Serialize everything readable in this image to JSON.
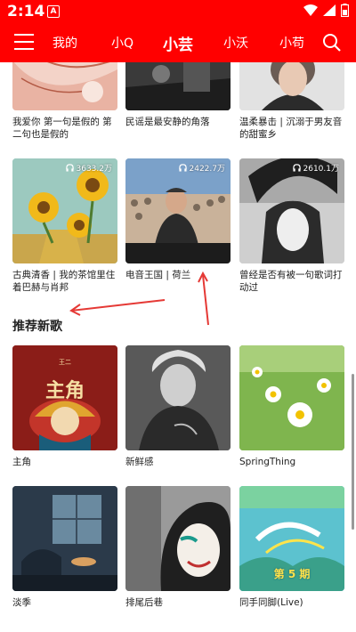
{
  "status": {
    "time": "2:14",
    "notification_glyph": "A"
  },
  "header": {
    "tabs": [
      {
        "label": "我的"
      },
      {
        "label": "小Q"
      },
      {
        "label": "小芸",
        "active": true
      },
      {
        "label": "小沃"
      },
      {
        "label": "小苟"
      }
    ]
  },
  "playlists": [
    {
      "caption": "我爱你 第一句是假的 第二句也是假的"
    },
    {
      "caption": "民谣是最安静的角落"
    },
    {
      "caption": "温柔暴击 | 沉溺于男友音的甜蜜乡"
    },
    {
      "caption": "古典清香 | 我的茶馆里住着巴赫与肖邦",
      "plays": "3633.2万"
    },
    {
      "caption": "电音王国 | 荷兰",
      "plays": "2422.7万"
    },
    {
      "caption": "曾经是否有被一句歌词打动过",
      "plays": "2610.1万"
    }
  ],
  "section": {
    "title": "推荐新歌"
  },
  "songs": [
    {
      "caption": "主角",
      "cover_text": "主角",
      "cover_small": "王二"
    },
    {
      "caption": "新鲜感"
    },
    {
      "caption": "SpringThing"
    },
    {
      "caption": "淡季"
    },
    {
      "caption": "排尾后巷"
    },
    {
      "caption": "同手同脚(Live)",
      "cover_badge": "第 5 期"
    }
  ],
  "colors": {
    "accent": "#ff0000",
    "annotation": "#e53935"
  }
}
